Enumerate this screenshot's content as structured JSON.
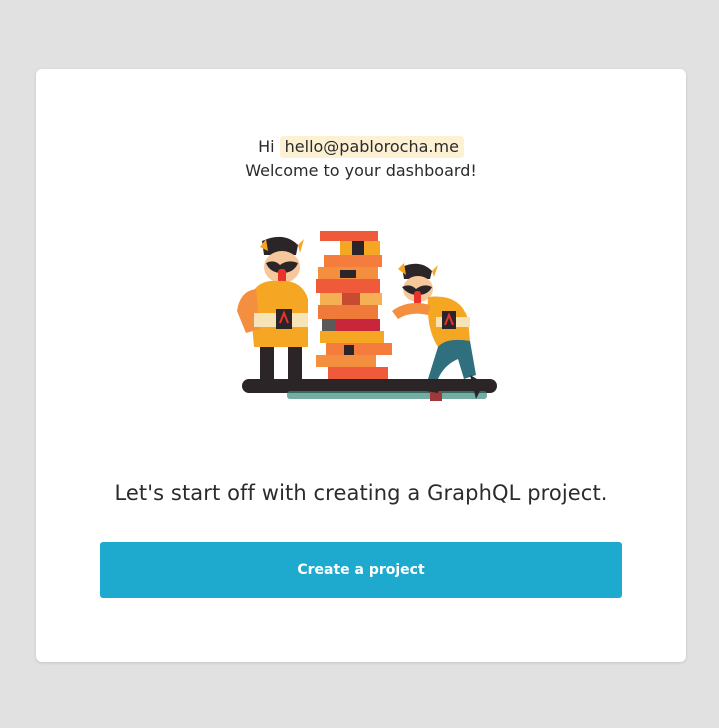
{
  "greeting": {
    "hi_label": "Hi",
    "email": "hello@pablorocha.me",
    "welcome": "Welcome to your dashboard!"
  },
  "illustration": {
    "icon": "jenga-tower-illustration"
  },
  "main": {
    "tagline": "Let's start off with creating a GraphQL project.",
    "create_button_label": "Create a project"
  },
  "colors": {
    "background": "#e1e1e1",
    "card": "#ffffff",
    "accent": "#1eaacf",
    "email_highlight": "#fdf1d4"
  }
}
